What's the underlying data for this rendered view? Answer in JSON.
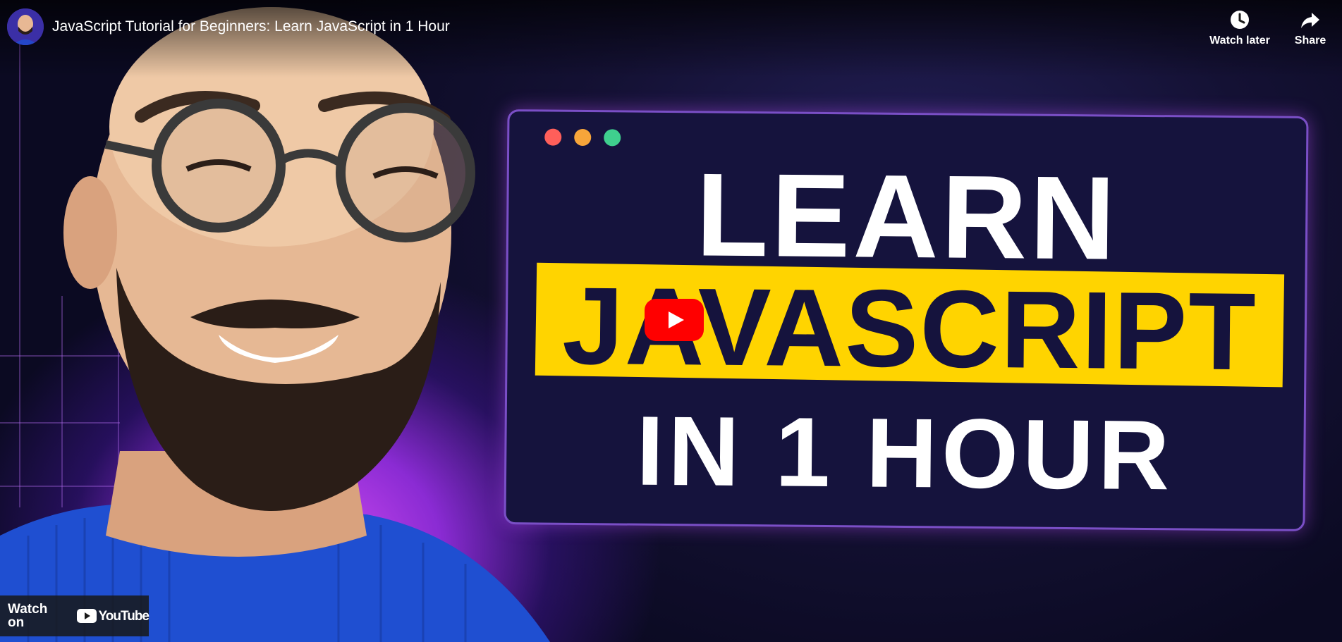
{
  "video": {
    "title": "JavaScript Tutorial for Beginners: Learn JavaScript in 1 Hour"
  },
  "actions": {
    "watch_later": "Watch later",
    "share": "Share"
  },
  "thumbnail": {
    "line1": "LEARN",
    "line2": "JAVASCRIPT",
    "line3": "IN 1 HOUR"
  },
  "footer": {
    "watch_on": "Watch on",
    "brand": "YouTube"
  },
  "icons": {
    "watch_later": "clock-icon",
    "share": "share-arrow-icon",
    "play": "play-button-icon",
    "brand": "youtube-logo-icon"
  },
  "colors": {
    "accent_yellow": "#ffd400",
    "youtube_red": "#ff0000",
    "card_bg": "#15133d",
    "glow_purple": "#d14bf2"
  }
}
